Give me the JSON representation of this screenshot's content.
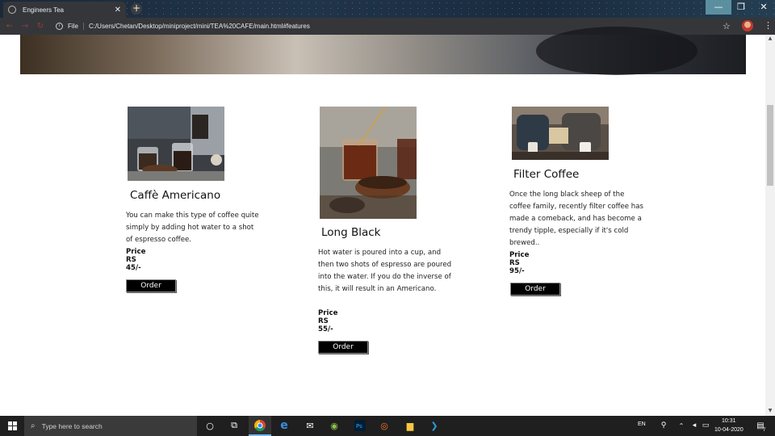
{
  "browser": {
    "tab_title": "Engineers Tea",
    "tab_close": "✕",
    "new_tab": "+",
    "address_prefix": "File",
    "url": "C:/Users/Chetan/Desktop/miniproject/mini/TEA%20CAFE/main.html#features",
    "window_controls": {
      "minimize": "—",
      "maximize": "❐",
      "close": "✕"
    }
  },
  "products": [
    {
      "title": "Caffè Americano",
      "description": "You can make this type of coffee quite simply by adding hot water to a shot of espresso coffee.",
      "price": "Price RS 45/-",
      "button": "Order"
    },
    {
      "title": "Long Black",
      "description": "Hot water is poured into a cup, and then two shots of espresso are poured into the water. If you do the inverse of this, it will result in an Americano.",
      "price": "Price RS 55/-",
      "button": "Order"
    },
    {
      "title": "Filter Coffee",
      "description": "Once the long black sheep of the coffee family, recently filter coffee has made a comeback, and has become a trendy tipple, especially if it's cold brewed..",
      "price": "Price RS 95/-",
      "button": "Order"
    }
  ],
  "taskbar": {
    "search_placeholder": "Type here to search",
    "language": "EN",
    "time": "10:31",
    "date": "10-04-2020",
    "notification_count": "7"
  },
  "colors": {
    "accent_active": "#76b9ed",
    "button_bg": "#000000"
  }
}
